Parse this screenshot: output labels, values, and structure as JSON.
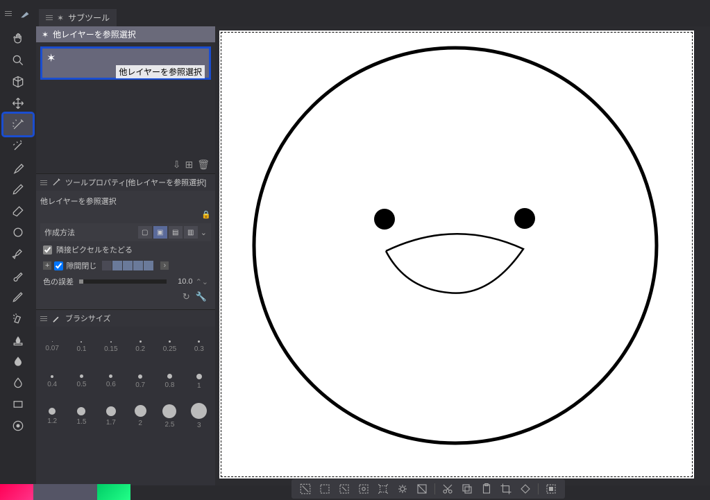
{
  "subtool_tab_label": "サブツール",
  "subtool_group_label": "他レイヤーを参照選択",
  "subtool_selected_label": "他レイヤーを参照選択",
  "tool_property_title": "ツールプロパティ[他レイヤーを参照選択]",
  "tool_property_subtitle": "他レイヤーを参照選択",
  "creation_method_label": "作成方法",
  "adjacent_pixels_label": "隣接ピクセルをたどる",
  "gap_close_label": "隙間閉じ",
  "color_tolerance_label": "色の誤差",
  "color_tolerance_value": "10.0",
  "brush_size_title": "ブラシサイズ",
  "brush_sizes": [
    {
      "label": "0.07",
      "d": 1
    },
    {
      "label": "0.1",
      "d": 2
    },
    {
      "label": "0.15",
      "d": 2
    },
    {
      "label": "0.2",
      "d": 3
    },
    {
      "label": "0.25",
      "d": 3
    },
    {
      "label": "0.3",
      "d": 3
    },
    {
      "label": "0.4",
      "d": 4
    },
    {
      "label": "0.5",
      "d": 5
    },
    {
      "label": "0.6",
      "d": 5
    },
    {
      "label": "0.7",
      "d": 6
    },
    {
      "label": "0.8",
      "d": 7
    },
    {
      "label": "1",
      "d": 8
    },
    {
      "label": "1.2",
      "d": 10
    },
    {
      "label": "1.5",
      "d": 12
    },
    {
      "label": "1.7",
      "d": 14
    },
    {
      "label": "2",
      "d": 17
    },
    {
      "label": "2.5",
      "d": 20
    },
    {
      "label": "3",
      "d": 23
    }
  ],
  "tools": [
    {
      "name": "move-tool",
      "icon": "hand"
    },
    {
      "name": "zoom-tool",
      "icon": "zoom"
    },
    {
      "name": "3d-tool",
      "icon": "cube"
    },
    {
      "name": "transform-tool",
      "icon": "arrows"
    },
    {
      "name": "auto-select-tool",
      "icon": "wand",
      "selected": true
    },
    {
      "name": "magic-wand-tool",
      "icon": "wand2"
    },
    {
      "name": "eyedropper-tool",
      "icon": "eyedropper"
    },
    {
      "name": "pen-tool",
      "icon": "pen"
    },
    {
      "name": "eraser-tool",
      "icon": "eraser"
    },
    {
      "name": "shape-tool",
      "icon": "shape"
    },
    {
      "name": "marker-tool",
      "icon": "marker"
    },
    {
      "name": "brush-tool",
      "icon": "brush"
    },
    {
      "name": "pencil-tool",
      "icon": "pencil"
    },
    {
      "name": "airbrush-tool",
      "icon": "airbrush"
    },
    {
      "name": "blend-tool",
      "icon": "blend"
    },
    {
      "name": "fill-tool",
      "icon": "fill"
    },
    {
      "name": "blur-tool",
      "icon": "blur"
    },
    {
      "name": "rect-tool",
      "icon": "rect"
    },
    {
      "name": "text-tool",
      "icon": "text"
    }
  ],
  "bottom_tools": [
    "deselect-icon",
    "rect-select-icon",
    "poly-select-icon",
    "lasso-icon",
    "shrink-icon",
    "expand-icon",
    "invert-icon",
    "sep",
    "cut-icon",
    "copy-icon",
    "paste-icon",
    "crop-icon",
    "fill-sel-icon",
    "sep",
    "save-sel-icon"
  ]
}
